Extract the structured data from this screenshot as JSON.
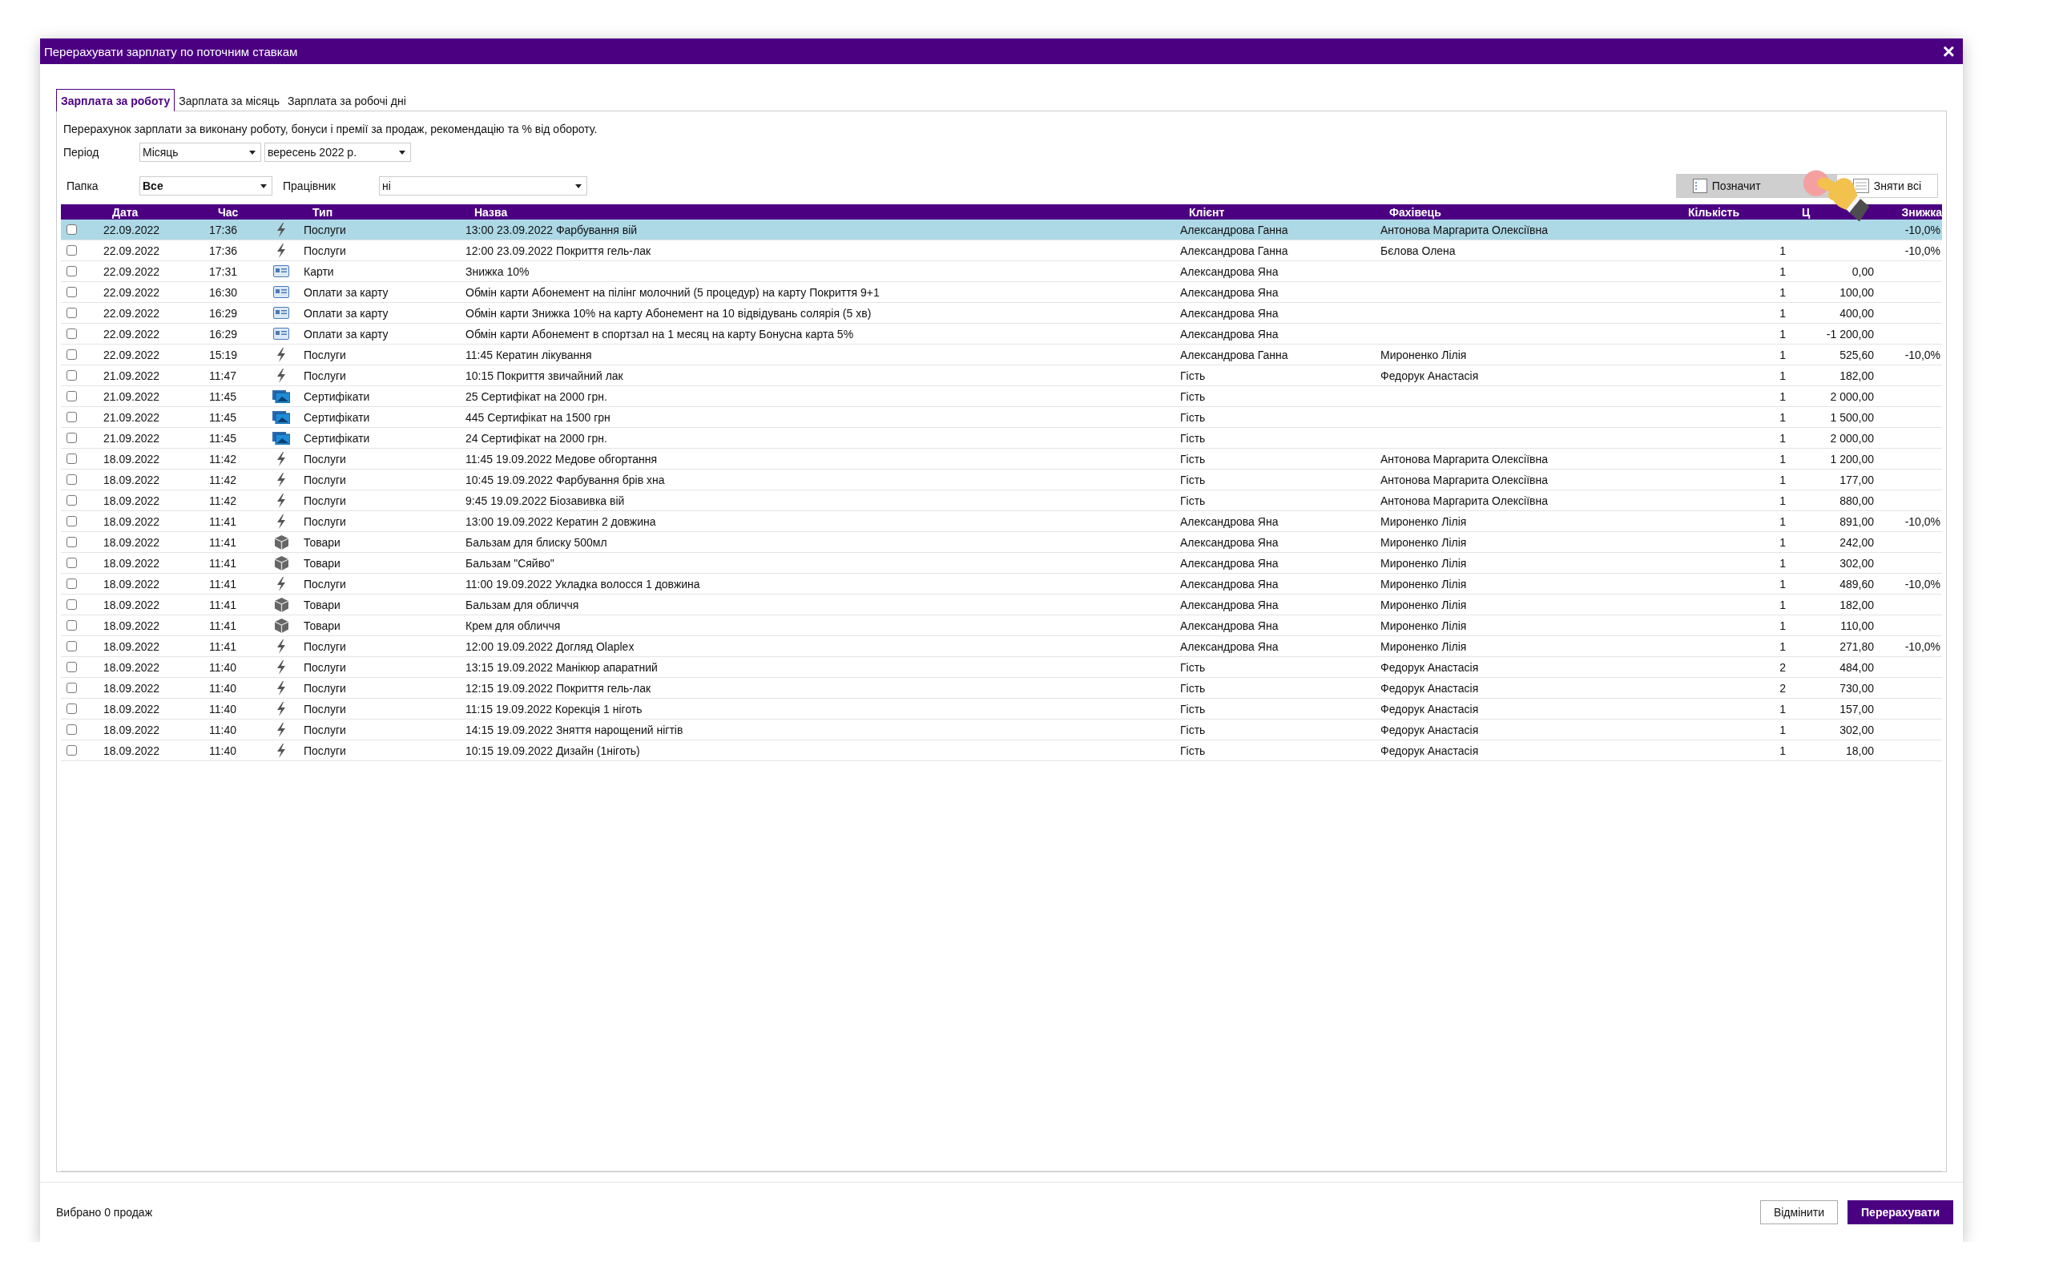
{
  "window": {
    "title": "Перерахувати зарплату по поточним ставкам",
    "close": "×"
  },
  "tabs": [
    {
      "label": "Зарплата за роботу",
      "selected": true
    },
    {
      "label": "Зарплата за місяць",
      "selected": false
    },
    {
      "label": "Зарплата за робочі дні",
      "selected": false
    }
  ],
  "description": "Перерахунок зарплати за виконану роботу, бонуси і премії за продаж, рекомендацію та % від обороту.",
  "filters": {
    "period_label": "Період",
    "period": "Місяць",
    "month": "вересень  2022 р.",
    "folder_label": "Папка",
    "folder": "Все",
    "employee_label": "Працівник",
    "employee": "ні"
  },
  "selection_buttons": [
    {
      "label": "Позначит",
      "kind": "check_all",
      "hovered": true
    },
    {
      "label": "Зняти всі",
      "kind": "uncheck_all",
      "hovered": false
    }
  ],
  "table": {
    "columns": [
      "Дата",
      "Час",
      "Тип",
      "Назва",
      "Клієнт",
      "Фахівець",
      "Кількість",
      "Ц",
      "Знижка"
    ],
    "rows": [
      {
        "checked": false,
        "selected": true,
        "date": "22.09.2022",
        "time": "17:36",
        "kind": "service",
        "type": "Послуги",
        "name": "13:00 23.09.2022 Фарбування вій",
        "client": "Александрова Ганна",
        "specialist": "Антонова Маргарита Олексіївна",
        "discount": "-10,0%"
      },
      {
        "checked": false,
        "selected": false,
        "date": "22.09.2022",
        "time": "17:36",
        "kind": "service",
        "type": "Послуги",
        "name": "12:00 23.09.2022 Покриття гель-лак",
        "client": "Александрова Ганна",
        "specialist": "Бєлова Олена",
        "quantity": "1",
        "discount": "-10,0%"
      },
      {
        "checked": false,
        "selected": false,
        "date": "22.09.2022",
        "time": "17:31",
        "kind": "card",
        "type": "Карти",
        "name": "Знижка 10%",
        "client": "Александрова Яна",
        "quantity": "1",
        "price": "0,00"
      },
      {
        "checked": false,
        "selected": false,
        "date": "22.09.2022",
        "time": "16:30",
        "kind": "card",
        "type": "Оплати за карту",
        "name": "Обмін карти Абонемент на пілінг молочний (5 процедур) на карту Покриття 9+1",
        "client": "Александрова Яна",
        "quantity": "1",
        "price": "100,00"
      },
      {
        "checked": false,
        "selected": false,
        "date": "22.09.2022",
        "time": "16:29",
        "kind": "card",
        "type": "Оплати за карту",
        "name": "Обмін карти Знижка 10% на карту Абонемент на 10 відвідувань солярія (5 хв)",
        "client": "Александрова Яна",
        "quantity": "1",
        "price": "400,00"
      },
      {
        "checked": false,
        "selected": false,
        "date": "22.09.2022",
        "time": "16:29",
        "kind": "card",
        "type": "Оплати за карту",
        "name": "Обмін карти Абонемент в спортзал на 1 месяц на карту Бонусна карта 5%",
        "client": "Александрова Яна",
        "quantity": "1",
        "price": "-1 200,00"
      },
      {
        "checked": false,
        "selected": false,
        "date": "22.09.2022",
        "time": "15:19",
        "kind": "service",
        "type": "Послуги",
        "name": "11:45 Кератин лікування",
        "client": "Александрова Ганна",
        "specialist": "Мироненко Лілія",
        "quantity": "1",
        "price": "525,60",
        "discount": "-10,0%"
      },
      {
        "checked": false,
        "selected": false,
        "date": "21.09.2022",
        "time": "11:47",
        "kind": "service",
        "type": "Послуги",
        "name": "10:15 Покриття звичайний лак",
        "client": "Гість",
        "specialist": "Федорук Анастасія",
        "quantity": "1",
        "price": "182,00"
      },
      {
        "checked": false,
        "selected": false,
        "date": "21.09.2022",
        "time": "11:45",
        "kind": "certificate",
        "type": "Сертифікати",
        "name": "25 Сертифікат на 2000 грн.",
        "client": "Гість",
        "quantity": "1",
        "price": "2 000,00"
      },
      {
        "checked": false,
        "selected": false,
        "date": "21.09.2022",
        "time": "11:45",
        "kind": "certificate",
        "type": "Сертифікати",
        "name": "445 Сертифікат на 1500 грн",
        "client": "Гість",
        "quantity": "1",
        "price": "1 500,00"
      },
      {
        "checked": false,
        "selected": false,
        "date": "21.09.2022",
        "time": "11:45",
        "kind": "certificate",
        "type": "Сертифікати",
        "name": "24 Сертифікат на 2000 грн.",
        "client": "Гість",
        "quantity": "1",
        "price": "2 000,00"
      },
      {
        "checked": false,
        "selected": false,
        "date": "18.09.2022",
        "time": "11:42",
        "kind": "service",
        "type": "Послуги",
        "name": "11:45 19.09.2022 Медове обгортання",
        "client": "Гість",
        "specialist": "Антонова Маргарита Олексіївна",
        "quantity": "1",
        "price": "1 200,00"
      },
      {
        "checked": false,
        "selected": false,
        "date": "18.09.2022",
        "time": "11:42",
        "kind": "service",
        "type": "Послуги",
        "name": "10:45 19.09.2022 Фарбування брів хна",
        "client": "Гість",
        "specialist": "Антонова Маргарита Олексіївна",
        "quantity": "1",
        "price": "177,00"
      },
      {
        "checked": false,
        "selected": false,
        "date": "18.09.2022",
        "time": "11:42",
        "kind": "service",
        "type": "Послуги",
        "name": "9:45 19.09.2022 Біозавивка вій",
        "client": "Гість",
        "specialist": "Антонова Маргарита Олексіївна",
        "quantity": "1",
        "price": "880,00"
      },
      {
        "checked": false,
        "selected": false,
        "date": "18.09.2022",
        "time": "11:41",
        "kind": "service",
        "type": "Послуги",
        "name": "13:00 19.09.2022 Кератин 2 довжина",
        "client": "Александрова Яна",
        "specialist": "Мироненко Лілія",
        "quantity": "1",
        "price": "891,00",
        "discount": "-10,0%"
      },
      {
        "checked": false,
        "selected": false,
        "date": "18.09.2022",
        "time": "11:41",
        "kind": "product",
        "type": "Товари",
        "name": "Бальзам для блиску 500мл",
        "client": "Александрова Яна",
        "specialist": "Мироненко Лілія",
        "quantity": "1",
        "price": "242,00"
      },
      {
        "checked": false,
        "selected": false,
        "date": "18.09.2022",
        "time": "11:41",
        "kind": "product",
        "type": "Товари",
        "name": "Бальзам \"Сяйво\"",
        "client": "Александрова Яна",
        "specialist": "Мироненко Лілія",
        "quantity": "1",
        "price": "302,00"
      },
      {
        "checked": false,
        "selected": false,
        "date": "18.09.2022",
        "time": "11:41",
        "kind": "service",
        "type": "Послуги",
        "name": "11:00 19.09.2022 Укладка волосся 1 довжина",
        "client": "Александрова Яна",
        "specialist": "Мироненко Лілія",
        "quantity": "1",
        "price": "489,60",
        "discount": "-10,0%"
      },
      {
        "checked": false,
        "selected": false,
        "date": "18.09.2022",
        "time": "11:41",
        "kind": "product",
        "type": "Товари",
        "name": "Бальзам для обличчя",
        "client": "Александрова Яна",
        "specialist": "Мироненко Лілія",
        "quantity": "1",
        "price": "182,00"
      },
      {
        "checked": false,
        "selected": false,
        "date": "18.09.2022",
        "time": "11:41",
        "kind": "product",
        "type": "Товари",
        "name": "Крем для обличчя",
        "client": "Александрова Яна",
        "specialist": "Мироненко Лілія",
        "quantity": "1",
        "price": "110,00"
      },
      {
        "checked": false,
        "selected": false,
        "date": "18.09.2022",
        "time": "11:41",
        "kind": "service",
        "type": "Послуги",
        "name": "12:00 19.09.2022 Догляд Olaplex",
        "client": "Александрова Яна",
        "specialist": "Мироненко Лілія",
        "quantity": "1",
        "price": "271,80",
        "discount": "-10,0%"
      },
      {
        "checked": false,
        "selected": false,
        "date": "18.09.2022",
        "time": "11:40",
        "kind": "service",
        "type": "Послуги",
        "name": "13:15 19.09.2022 Манікюр апаратний",
        "client": "Гість",
        "specialist": "Федорук Анастасія",
        "quantity": "2",
        "price": "484,00"
      },
      {
        "checked": false,
        "selected": false,
        "date": "18.09.2022",
        "time": "11:40",
        "kind": "service",
        "type": "Послуги",
        "name": "12:15 19.09.2022 Покриття гель-лак",
        "client": "Гість",
        "specialist": "Федорук Анастасія",
        "quantity": "2",
        "price": "730,00"
      },
      {
        "checked": false,
        "selected": false,
        "date": "18.09.2022",
        "time": "11:40",
        "kind": "service",
        "type": "Послуги",
        "name": "11:15 19.09.2022 Корекція 1 ніготь",
        "client": "Гість",
        "specialist": "Федорук Анастасія",
        "quantity": "1",
        "price": "157,00"
      },
      {
        "checked": false,
        "selected": false,
        "date": "18.09.2022",
        "time": "11:40",
        "kind": "service",
        "type": "Послуги",
        "name": "14:15 19.09.2022 Зняття нарощений нігтів",
        "client": "Гість",
        "specialist": "Федорук Анастасія",
        "quantity": "1",
        "price": "302,00"
      },
      {
        "checked": false,
        "selected": false,
        "date": "18.09.2022",
        "time": "11:40",
        "kind": "service",
        "type": "Послуги",
        "name": "10:15 19.09.2022 Дизайн (1ніготь)",
        "client": "Гість",
        "specialist": "Федорук Анастасія",
        "quantity": "1",
        "price": "18,00"
      }
    ]
  },
  "status": "Вибрано 0 продаж",
  "footer_buttons": [
    {
      "label": "Відмінити",
      "kind": "secondary"
    },
    {
      "label": "Перерахувати",
      "kind": "primary"
    }
  ]
}
